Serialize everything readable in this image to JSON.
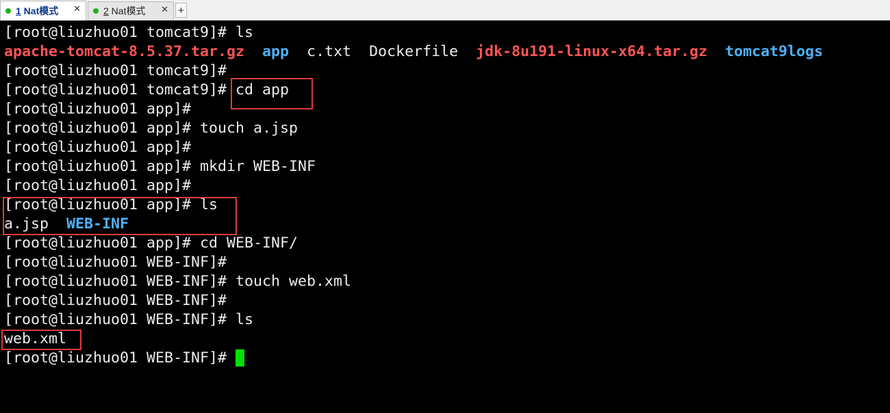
{
  "tabs": [
    {
      "number": "1",
      "label": " Nat模式",
      "close": "✕",
      "status_color": "#1bb31b",
      "active": true
    },
    {
      "number": "2",
      "label": " Nat模式",
      "close": "✕",
      "status_color": "#1bb31b",
      "active": false
    }
  ],
  "add_tab": "+",
  "terminal": {
    "prompt_tomcat9": "[root@liuzhuo01 tomcat9]# ",
    "prompt_app": "[root@liuzhuo01 app]# ",
    "prompt_webinf": "[root@liuzhuo01 WEB-INF]# ",
    "prompt_tomcat9_bare": "[root@liuzhuo01 tomcat9]#",
    "prompt_app_bare": "[root@liuzhuo01 app]#",
    "prompt_webinf_bare": "[root@liuzhuo01 WEB-INF]#",
    "cmd_ls": "ls",
    "cmd_cd_app": "cd app",
    "cmd_touch_jsp": "touch a.jsp",
    "cmd_mkdir": "mkdir WEB-INF",
    "cmd_cd_webinf": "cd WEB-INF/",
    "cmd_touch_xml": "touch web.xml",
    "ls1": {
      "f1": "apache-tomcat-8.5.37.tar.gz",
      "f2": "app",
      "f3": "c.txt",
      "f4": "Dockerfile",
      "f5": "jdk-8u191-linux-x64.tar.gz",
      "f6": "tomcat9logs"
    },
    "ls2": {
      "f1": "a.jsp",
      "f2": "WEB-INF"
    },
    "ls3": {
      "f1": "web.xml"
    },
    "colors": {
      "archive": "#ff5454",
      "directory": "#4fb0f7",
      "cursor": "#00e000",
      "highlight": "#e03b3b"
    }
  }
}
